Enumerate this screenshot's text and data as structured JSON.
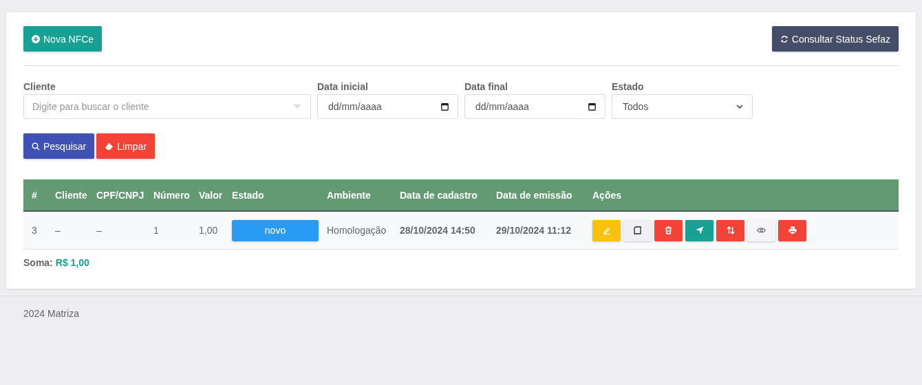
{
  "toolbar": {
    "new_button": "Nova NFCe",
    "status_button": "Consultar Status Sefaz"
  },
  "filters": [
    {
      "kind": "combo",
      "label": "Cliente",
      "placeholder": "Digite para buscar o cliente"
    },
    {
      "kind": "date",
      "label": "Data inicial",
      "placeholder": "dd/mm/aaaa"
    },
    {
      "kind": "date",
      "label": "Data final",
      "placeholder": "dd/mm/aaaa"
    },
    {
      "kind": "select",
      "label": "Estado",
      "value": "Todos"
    }
  ],
  "search_buttons": [
    {
      "kind": "search",
      "label": "Pesquisar"
    },
    {
      "kind": "clear",
      "label": "Limpar"
    }
  ],
  "table": {
    "columns": [
      "#",
      "Cliente",
      "CPF/CNPJ",
      "Número",
      "Valor",
      "Estado",
      "Ambiente",
      "Data de cadastro",
      "Data de emissão",
      "Ações"
    ],
    "rows": [
      {
        "id": "3",
        "cliente": "–",
        "cpf_cnpj": "–",
        "numero": "1",
        "valor": "1,00",
        "estado": "novo",
        "ambiente": "Homologação",
        "data_cadastro": "28/10/2024 14:50",
        "data_emissao": "29/10/2024 11:12",
        "actions": [
          {
            "kind": "edit"
          },
          {
            "kind": "copy"
          },
          {
            "kind": "delete"
          },
          {
            "kind": "send"
          },
          {
            "kind": "swap"
          },
          {
            "kind": "view"
          },
          {
            "kind": "print"
          }
        ]
      }
    ]
  },
  "total": {
    "label": "Soma:",
    "value": "R$ 1,00"
  },
  "footer": "2024 Matriza"
}
